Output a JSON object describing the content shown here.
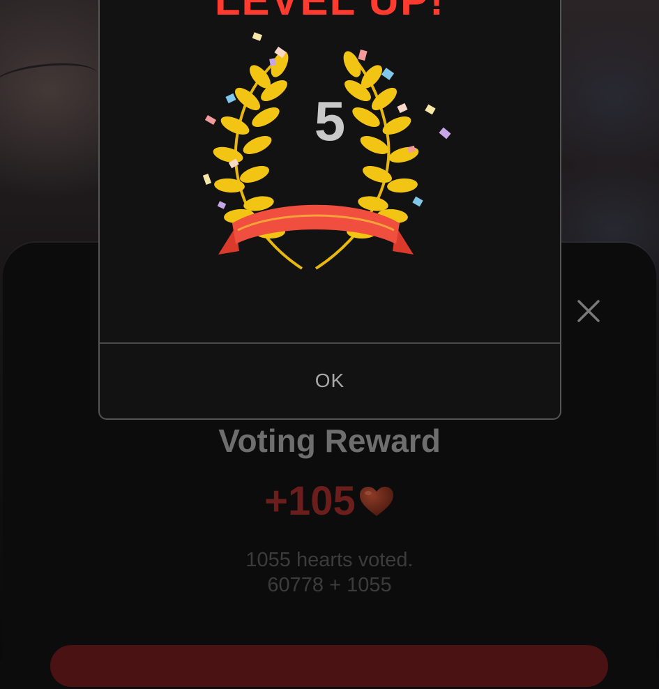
{
  "dialog": {
    "heading": "LEVEL UP!",
    "level": "5",
    "ok_label": "OK"
  },
  "reward": {
    "title": "Voting Reward",
    "amount": "+105",
    "voted_text": "1055 hearts voted.",
    "equation": "60778 + 1055"
  },
  "icons": {
    "close": "close-icon",
    "heart": "heart-icon",
    "wreath": "laurel-wreath-icon"
  },
  "colors": {
    "heading": "#ff3b30",
    "wreath_gold": "#f2c414",
    "ribbon": "#f04e3e",
    "amount": "#6b1e1c",
    "dialog_bg": "#121212"
  }
}
